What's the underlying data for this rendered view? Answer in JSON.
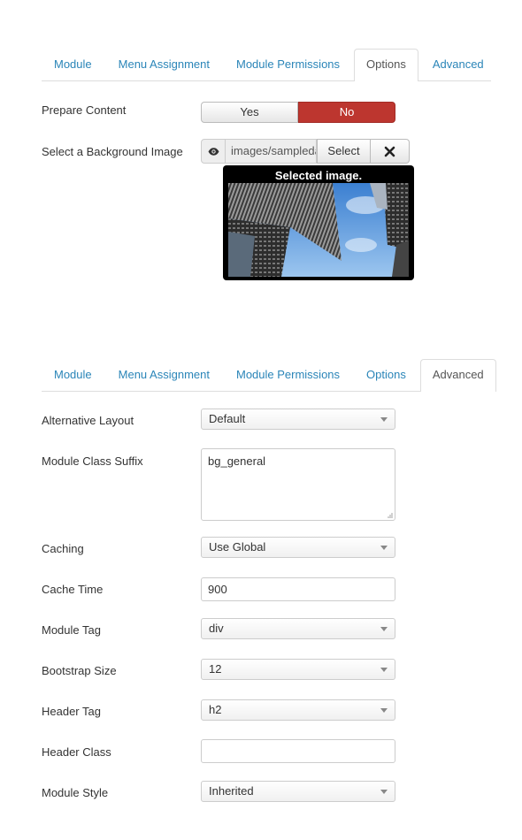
{
  "tabs_top": {
    "items": [
      {
        "label": "Module"
      },
      {
        "label": "Menu Assignment"
      },
      {
        "label": "Module Permissions"
      },
      {
        "label": "Options"
      },
      {
        "label": "Advanced"
      }
    ],
    "active": "Options"
  },
  "options": {
    "prepare_content": {
      "label": "Prepare Content",
      "yes_label": "Yes",
      "no_label": "No",
      "selected": "No"
    },
    "background_image": {
      "label": "Select a Background Image",
      "path_value": "images/sampledata",
      "select_label": "Select",
      "preview_caption": "Selected image."
    }
  },
  "tabs_bottom": {
    "items": [
      {
        "label": "Module"
      },
      {
        "label": "Menu Assignment"
      },
      {
        "label": "Module Permissions"
      },
      {
        "label": "Options"
      },
      {
        "label": "Advanced"
      }
    ],
    "active": "Advanced"
  },
  "advanced": {
    "alternative_layout": {
      "label": "Alternative Layout",
      "value": "Default"
    },
    "module_class_suffix": {
      "label": "Module Class Suffix",
      "value": "bg_general"
    },
    "caching": {
      "label": "Caching",
      "value": "Use Global"
    },
    "cache_time": {
      "label": "Cache Time",
      "value": "900"
    },
    "module_tag": {
      "label": "Module Tag",
      "value": "div"
    },
    "bootstrap_size": {
      "label": "Bootstrap Size",
      "value": "12"
    },
    "header_tag": {
      "label": "Header Tag",
      "value": "h2"
    },
    "header_class": {
      "label": "Header Class",
      "value": ""
    },
    "module_style": {
      "label": "Module Style",
      "value": "Inherited"
    }
  },
  "colors": {
    "link": "#2a85b8",
    "no_active": "#bd362f",
    "border": "#dddddd"
  },
  "icons": {
    "eye": "eye-icon",
    "clear": "close-icon",
    "caret": "chevron-down-icon"
  }
}
